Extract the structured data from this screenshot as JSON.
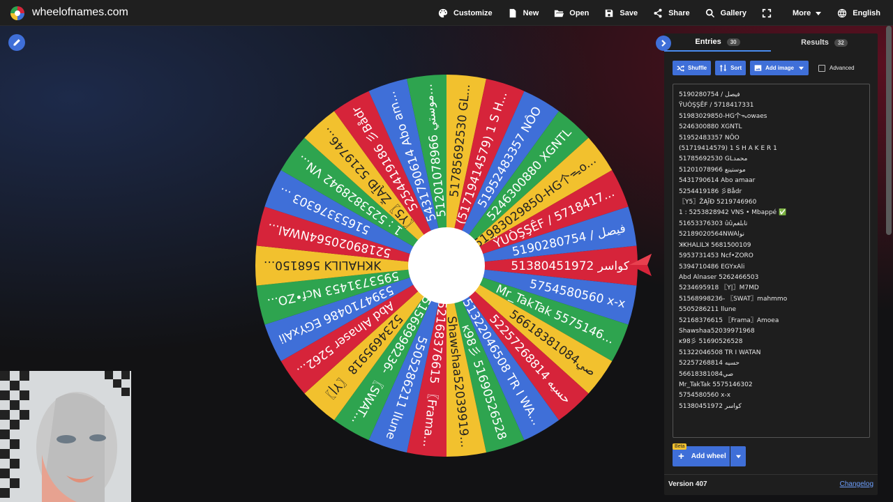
{
  "header": {
    "site_name": "wheelofnames.com",
    "menu": [
      {
        "label": "Customize",
        "icon": "palette-icon"
      },
      {
        "label": "New",
        "icon": "new-file-icon"
      },
      {
        "label": "Open",
        "icon": "folder-open-icon"
      },
      {
        "label": "Save",
        "icon": "floppy-icon"
      },
      {
        "label": "Share",
        "icon": "share-icon"
      },
      {
        "label": "Gallery",
        "icon": "search-icon"
      },
      {
        "label": "",
        "icon": "fullscreen-icon"
      },
      {
        "label": "More",
        "icon": "chevron-down-icon"
      },
      {
        "label": "English",
        "icon": "globe-icon"
      }
    ]
  },
  "colors": {
    "green": "#2ea44f",
    "yellow": "#f2c12e",
    "red": "#d6243a",
    "blue": "#3f6fd8",
    "accent": "#3f6fd8"
  },
  "wheel": {
    "segments": [
      "51380451972 كواسر",
      "5754580560 x-x",
      "Mr_TakTak 5575146...",
      "56618381084صي",
      "52257268814 حسيه",
      "51322046508 TR I WA...",
      "ĸ98彡 51690526528",
      "Shawshaa52039919...",
      "52168376615 〖Frama...",
      "5505286211 llune",
      "51568998236- 〖SWAT...",
      "5234695918 〖Y|〗",
      "Abd Alnaser 5262...",
      "5394710486 EGYxAli",
      "5953731453 Ncf•ZO...",
      "ꓘKHALILꓘ 568150...",
      "52189020564NWAl...",
      "51653376303 ...",
      "1 : 5253828942 VN...",
      "〖Y5〗ŽĄĪĐ 5219746...",
      "5254419186 彡Bådr",
      "5431790614 Abo am...",
      "51201078966 موستي...",
      "51785692530 GL...",
      "(51719414579) 1 S H...",
      "51952483357 NÔO",
      "5246300880 XGNTL",
      "51983029850-HG个ᯓo...",
      "ŸUÒŞŞÊF / 5718417...",
      "5190280754 / فيصل"
    ]
  },
  "panel": {
    "tabs": [
      {
        "label": "Entries",
        "count": "30"
      },
      {
        "label": "Results",
        "count": "32"
      }
    ],
    "toolbar": {
      "shuffle": "Shuffle",
      "sort": "Sort",
      "add_image": "Add image",
      "advanced": "Advanced"
    },
    "entries": [
      "5190280754 / فيصل",
      "ŸUÒŞŞÊF / 5718417331",
      "51983029850-HG个ᯓowaes",
      "5246300880 XGNTL",
      "51952483357 NÔO",
      "(51719414579) 1 S H A K E R 1",
      "51785692530 GLمحمد",
      "51201078966 موستينع",
      "5431790614 Abo amaar",
      "5254419186 彡Bådr",
      "〖Y5〗ŽĄĪĐ 5219746960",
      "1 : 5253828942 VNS • Mbappé ✅",
      "51653376303 ûûتابلغم",
      "52189020564NWAlنو",
      "ꓘKHALILꓘ 5681500109",
      "5953731453 Ncf•ZORO",
      "5394710486 EGYxAli",
      "Abd Alnaser 5262466503",
      "5234695918 〖Y|〗M7MD",
      "51568998236- 〖SWAT〗mahmmo",
      "5505286211 llune",
      "52168376615 〖Frama〗Amoea",
      "Shawshaa52039971968",
      "ĸ98彡 51690526528",
      "51322046508 TR I WATAN",
      "52257268814 حسيه",
      "56618381084صي",
      "Mr_TakTak 5575146302",
      "5754580560 x-x",
      "51380451972 كواسر"
    ],
    "add_wheel": {
      "beta": "Beta",
      "label": "Add wheel"
    },
    "version": "Version 407",
    "changelog": "Changelog"
  }
}
